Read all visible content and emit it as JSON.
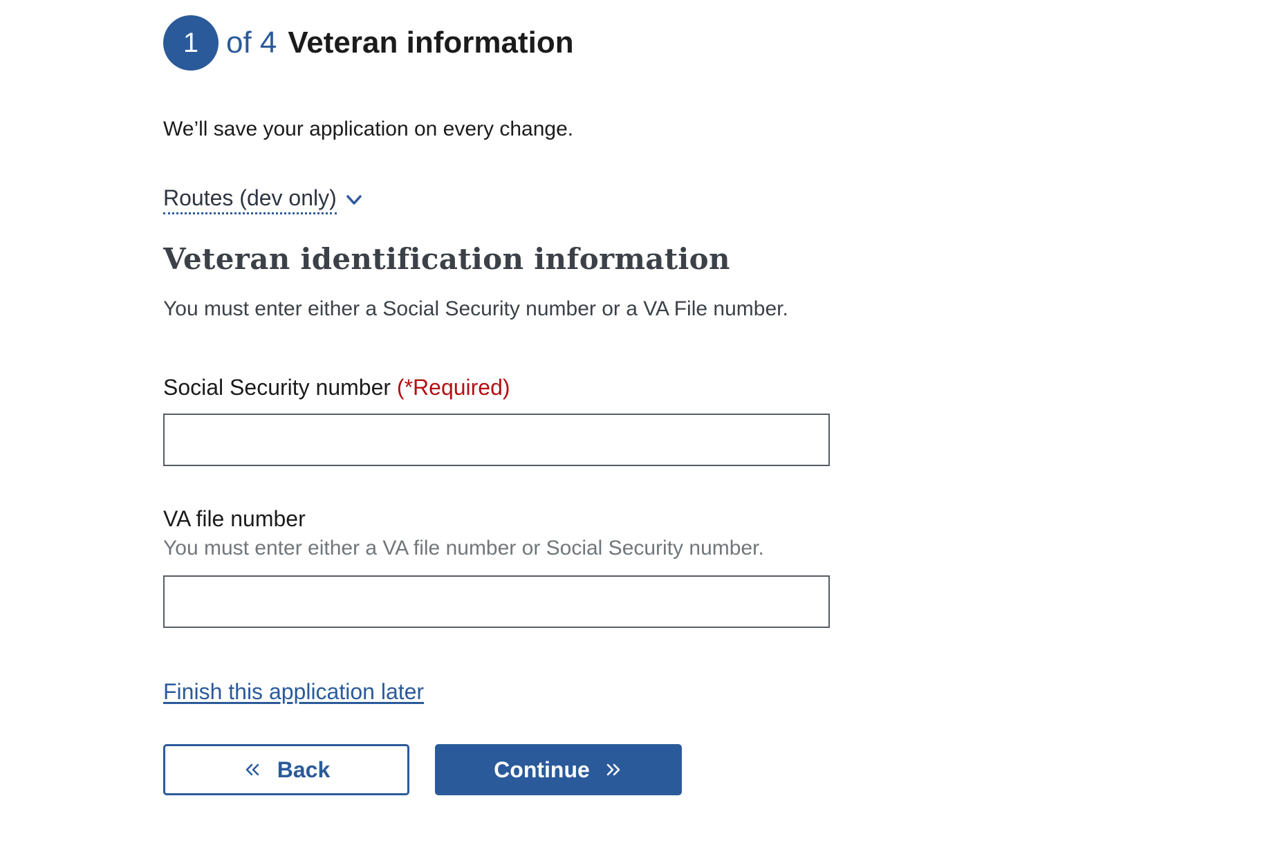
{
  "step": {
    "number": "1",
    "of_text": "of 4",
    "title": "Veteran information"
  },
  "save_note": "We’ll save your application on every change.",
  "routes": {
    "label": "Routes (dev only)",
    "icon": "chevron-down-icon"
  },
  "section": {
    "heading": "Veteran identification information",
    "hint": "You must enter either a Social Security number or a VA File number."
  },
  "ssn_field": {
    "label": "Social Security number",
    "required_text": "(*Required)",
    "value": ""
  },
  "va_file_field": {
    "label": "VA file number",
    "hint": "You must enter either a VA file number or Social Security number.",
    "value": ""
  },
  "finish_later_link": "Finish this application later",
  "buttons": {
    "back_label": "Back",
    "continue_label": "Continue"
  },
  "colors": {
    "primary": "#2a5a9a",
    "required": "#b40f12",
    "hint_gray": "#71767a",
    "heading_gray": "#3c4148"
  }
}
